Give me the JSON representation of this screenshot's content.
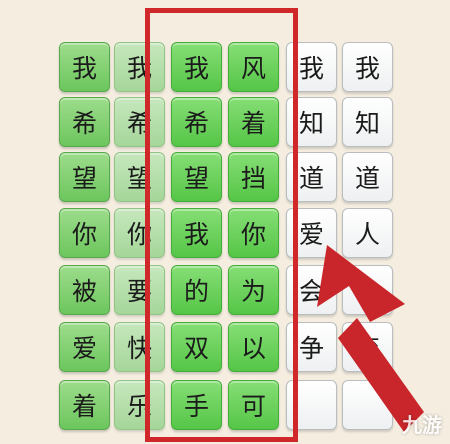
{
  "grid": {
    "columns": [
      {
        "style": "g1",
        "chars": [
          "我",
          "希",
          "望",
          "你",
          "被",
          "爱",
          "着"
        ]
      },
      {
        "style": "g2",
        "chars": [
          "我",
          "希",
          "望",
          "你",
          "要",
          "快",
          "乐"
        ]
      },
      {
        "style": "g3",
        "chars": [
          "我",
          "希",
          "望",
          "我",
          "的",
          "双",
          "手"
        ]
      },
      {
        "style": "g3",
        "chars": [
          "风",
          "着",
          "挡",
          "你",
          "为",
          "以",
          "可"
        ]
      },
      {
        "style": "w",
        "chars": [
          "我",
          "知",
          "道",
          "爱",
          "会",
          "争",
          ""
        ]
      },
      {
        "style": "w",
        "chars": [
          "我",
          "知",
          "道",
          "人",
          "会",
          "变",
          ""
        ]
      }
    ]
  },
  "highlight_color": "#d0282a",
  "watermark": "九游"
}
